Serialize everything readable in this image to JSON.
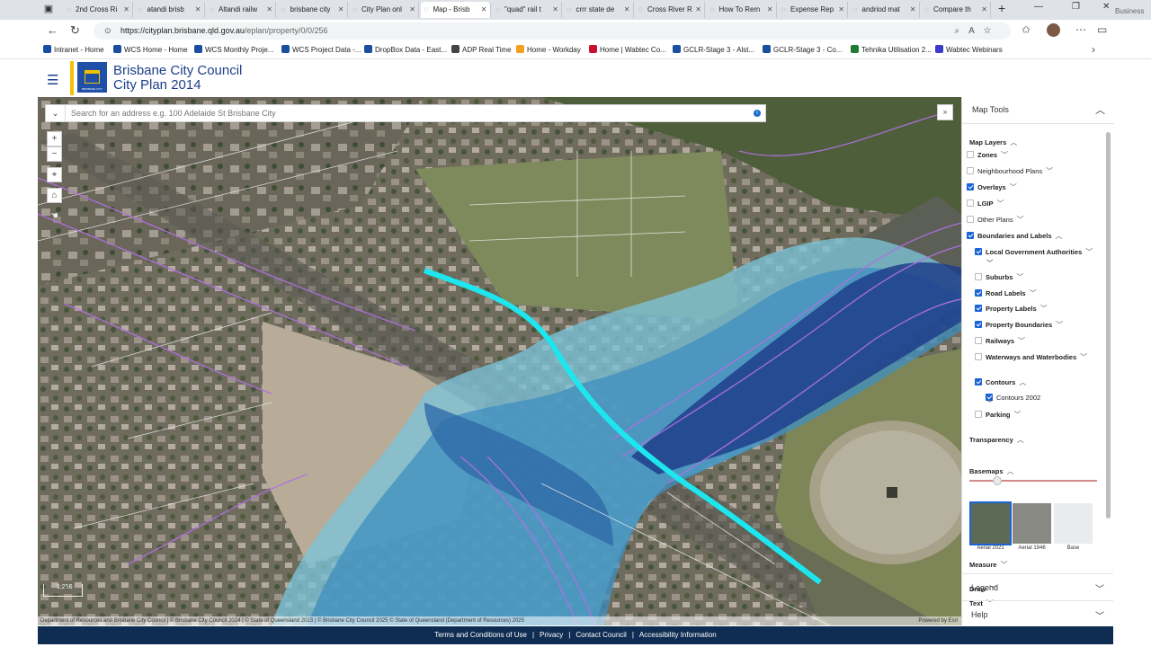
{
  "browser": {
    "tabs": [
      {
        "label": "2nd Cross Ri"
      },
      {
        "label": "atandi brisb"
      },
      {
        "label": "Altandi railw"
      },
      {
        "label": "brisbane city"
      },
      {
        "label": "City Plan onl"
      },
      {
        "label": "Map - Brisb",
        "active": true
      },
      {
        "label": "\"quad\" rail t"
      },
      {
        "label": "crrr state de"
      },
      {
        "label": "Cross River R"
      },
      {
        "label": "How To Rem"
      },
      {
        "label": "Expense Rep"
      },
      {
        "label": "andriod mat"
      },
      {
        "label": "Compare th"
      }
    ],
    "profile_label": "Business",
    "url_host": "https://cityplan.brisbane.qld.gov.au",
    "url_path": "/eplan/property/0/0/256",
    "bookmarks": [
      {
        "label": "Intranet - Home",
        "color": "#1a4fa0"
      },
      {
        "label": "WCS Home - Home",
        "color": "#1a4fa0"
      },
      {
        "label": "WCS Monthly Proje...",
        "color": "#1a4fa0"
      },
      {
        "label": "WCS Project Data -...",
        "color": "#1a4fa0"
      },
      {
        "label": "DropBox Data - East...",
        "color": "#1a4fa0"
      },
      {
        "label": "ADP Real Time",
        "color": "#444444"
      },
      {
        "label": "Home - Workday",
        "color": "#f3a021"
      },
      {
        "label": "Home | Wabtec Co...",
        "color": "#c8102e"
      },
      {
        "label": "GCLR-Stage 3 - Alst...",
        "color": "#1a4fa0"
      },
      {
        "label": "GCLR-Stage 3 - Co...",
        "color": "#1a4fa0"
      },
      {
        "label": "Tehnika Utilisation 2...",
        "color": "#1e7b34"
      },
      {
        "label": "Wabtec Webinars",
        "color": "#3a3acb"
      }
    ]
  },
  "header": {
    "title_line1": "Brisbane City Council",
    "title_line2": "City Plan 2014",
    "logo_text": "BRISBANE CITY"
  },
  "map": {
    "search_placeholder": "Search for an address e.g. 100 Adelaide St Brisbane City",
    "scale_text": "1:256",
    "attribution": "Department of Resources and Brisbane City Council | © Brisbane City Council 2024 | © State of Queensland 2023 | © Brisbane City Council 2025 © State of Queensland (Department of Resources) 2025",
    "powered_by": "Powered by Esri"
  },
  "panel": {
    "title": "Map Tools",
    "map_layers_label": "Map Layers",
    "layers": [
      {
        "label": "Zones",
        "checked": false
      },
      {
        "label": "Neighbourhood Plans",
        "checked": false
      },
      {
        "label": "Overlays",
        "checked": true
      },
      {
        "label": "LGIP",
        "checked": false
      },
      {
        "label": "Other Plans",
        "checked": false
      },
      {
        "label": "Boundaries and Labels",
        "checked": true
      },
      {
        "label": "Local Government Authorities",
        "checked": true
      },
      {
        "label": "Suburbs",
        "checked": false
      },
      {
        "label": "Road Labels",
        "checked": true
      },
      {
        "label": "Property Labels",
        "checked": true
      },
      {
        "label": "Property Boundaries",
        "checked": true
      },
      {
        "label": "Railways",
        "checked": false
      },
      {
        "label": "Waterways and Waterbodies",
        "checked": false
      },
      {
        "label": "Contours",
        "checked": true
      },
      {
        "label": "Contours 2002",
        "checked": true
      },
      {
        "label": "Parking",
        "checked": false
      }
    ],
    "transparency_label": "Transparency",
    "transparency_level": 0.22,
    "basemaps_label": "Basemaps",
    "basemaps": [
      {
        "label": "Aerial 2021",
        "selected": true
      },
      {
        "label": "Aerial 1946",
        "selected": false
      },
      {
        "label": "Base",
        "selected": false
      }
    ],
    "measure_label": "Measure",
    "draw_label": "Draw",
    "text_label": "Text",
    "legend_label": "Legend",
    "help_label": "Help"
  },
  "footer": {
    "links": [
      "Terms and Conditions of Use",
      "Privacy",
      "Contact Council",
      "Accessibility Information"
    ],
    "separator": "|"
  },
  "colors": {
    "brand_blue": "#1b3f8b",
    "footer_navy": "#0f2d52",
    "checkbox_blue": "#1a64d6",
    "alignment_cyan": "#1ee6ee",
    "contour_purple": "#b070e0"
  }
}
